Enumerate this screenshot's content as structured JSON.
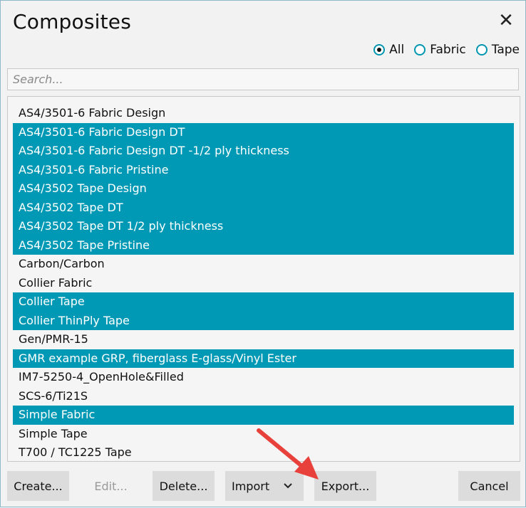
{
  "window": {
    "title": "Composites",
    "close_glyph": "✕"
  },
  "filters": {
    "selected": "All",
    "options": [
      {
        "label": "All",
        "checked": true
      },
      {
        "label": "Fabric",
        "checked": false
      },
      {
        "label": "Tape",
        "checked": false
      }
    ]
  },
  "search": {
    "placeholder": "Search...",
    "value": ""
  },
  "list": {
    "items": [
      {
        "label": "AS4/3501-6 Fabric Design",
        "selected": false
      },
      {
        "label": "AS4/3501-6 Fabric Design DT",
        "selected": true
      },
      {
        "label": "AS4/3501-6 Fabric Design DT -1/2 ply thickness",
        "selected": true
      },
      {
        "label": "AS4/3501-6 Fabric Pristine",
        "selected": true
      },
      {
        "label": "AS4/3502 Tape Design",
        "selected": true
      },
      {
        "label": "AS4/3502 Tape DT",
        "selected": true
      },
      {
        "label": "AS4/3502 Tape DT 1/2 ply thickness",
        "selected": true
      },
      {
        "label": "AS4/3502 Tape Pristine",
        "selected": true
      },
      {
        "label": "Carbon/Carbon",
        "selected": false
      },
      {
        "label": "Collier Fabric",
        "selected": false
      },
      {
        "label": "Collier Tape",
        "selected": true
      },
      {
        "label": "Collier ThinPly Tape",
        "selected": true
      },
      {
        "label": "Gen/PMR-15",
        "selected": false
      },
      {
        "label": "GMR example GRP, fiberglass E-glass/Vinyl Ester",
        "selected": true
      },
      {
        "label": "IM7-5250-4_OpenHole&Filled",
        "selected": false
      },
      {
        "label": "SCS-6/Ti21S",
        "selected": false
      },
      {
        "label": "Simple Fabric",
        "selected": true
      },
      {
        "label": "Simple Tape",
        "selected": false
      },
      {
        "label": "T700 / TC1225 Tape",
        "selected": false
      }
    ]
  },
  "buttons": {
    "create": "Create...",
    "edit": "Edit...",
    "delete": "Delete...",
    "import": "Import",
    "export": "Export...",
    "cancel": "Cancel"
  },
  "colors": {
    "selection": "#0099b5",
    "radio_accent": "#0096b0",
    "annotation_arrow": "#e8403a"
  },
  "icons": {
    "close": "close-icon",
    "import_dropdown": "chevron-down-icon"
  }
}
